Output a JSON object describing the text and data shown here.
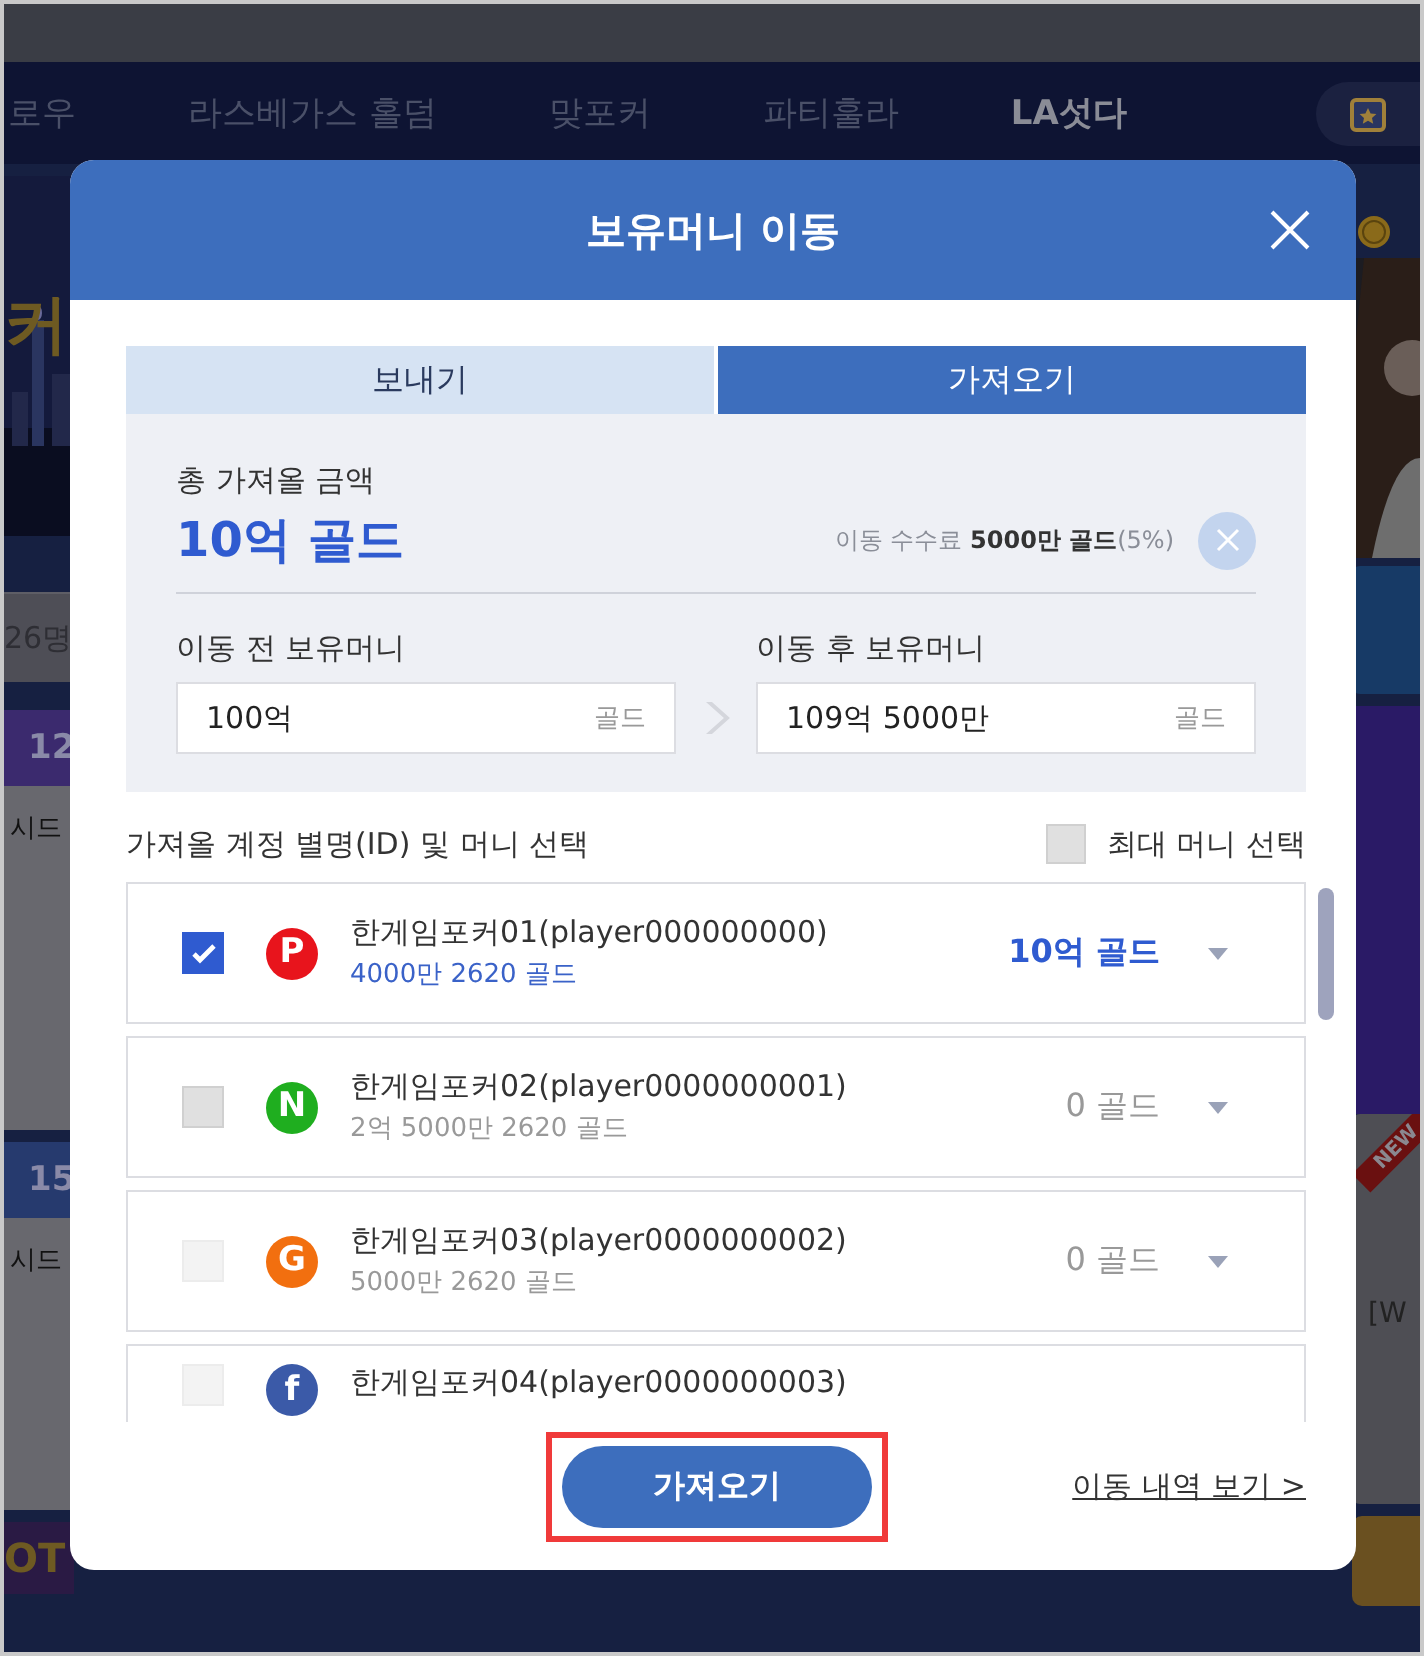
{
  "background": {
    "nav": [
      {
        "label": "로우",
        "selected": false
      },
      {
        "label": "라스베가스 홀덤",
        "selected": false
      },
      {
        "label": "맞포커",
        "selected": false
      },
      {
        "label": "파티훌라",
        "selected": false
      },
      {
        "label": "LA섯다",
        "selected": true
      }
    ],
    "left": {
      "title_fragment": "커",
      "count": "26명",
      "cards": [
        {
          "badge": "12",
          "label": "시드",
          "color": "#3b2a6e"
        },
        {
          "badge": "15",
          "label": "시드",
          "color": "#263a6e"
        }
      ],
      "jackpot": "OT"
    },
    "right": {
      "ribbon": "NEW",
      "card_text": "[W"
    }
  },
  "modal": {
    "title": "보유머니 이동",
    "tabs": [
      {
        "label": "보내기",
        "selected": false
      },
      {
        "label": "가져오기",
        "selected": true
      }
    ],
    "summary": {
      "label": "총 가져올 금액",
      "amount": "10억 골드",
      "fee": "이동 수수료 **5000만 골드**(5%)",
      "before": {
        "label": "이동 전 보유머니",
        "value": "100억",
        "unit": "골드"
      },
      "after": {
        "label": "이동 후 보유머니",
        "value": "109억 5000만",
        "unit": "골드"
      }
    },
    "list": {
      "label": "가져올 계정 별명(ID) 및 머니 선택",
      "max_select": {
        "label": "최대 머니 선택",
        "checked": false
      },
      "accounts": [
        {
          "name": "한게임포커01(player000000000)",
          "balance": "4000만 2620 골드",
          "amount": "10억 골드",
          "badge": "P",
          "color": "#e8141c",
          "checked": true,
          "disabled": false
        },
        {
          "name": "한게임포커02(player0000000001)",
          "balance": "2억 5000만 2620 골드",
          "amount": "0 골드",
          "badge": "N",
          "color": "#1fae1f",
          "checked": false,
          "disabled": false
        },
        {
          "name": "한게임포커03(player0000000002)",
          "balance": "5000만 2620 골드",
          "amount": "0 골드",
          "badge": "G",
          "color": "#f26f0f",
          "checked": false,
          "disabled": true
        },
        {
          "name": "한게임포커04(player0000000003)",
          "badge": "f",
          "color": "#3b5aa8",
          "checked": false,
          "disabled": true
        }
      ]
    },
    "submit": "가져오기",
    "history_link": "이동 내역 보기 >"
  }
}
